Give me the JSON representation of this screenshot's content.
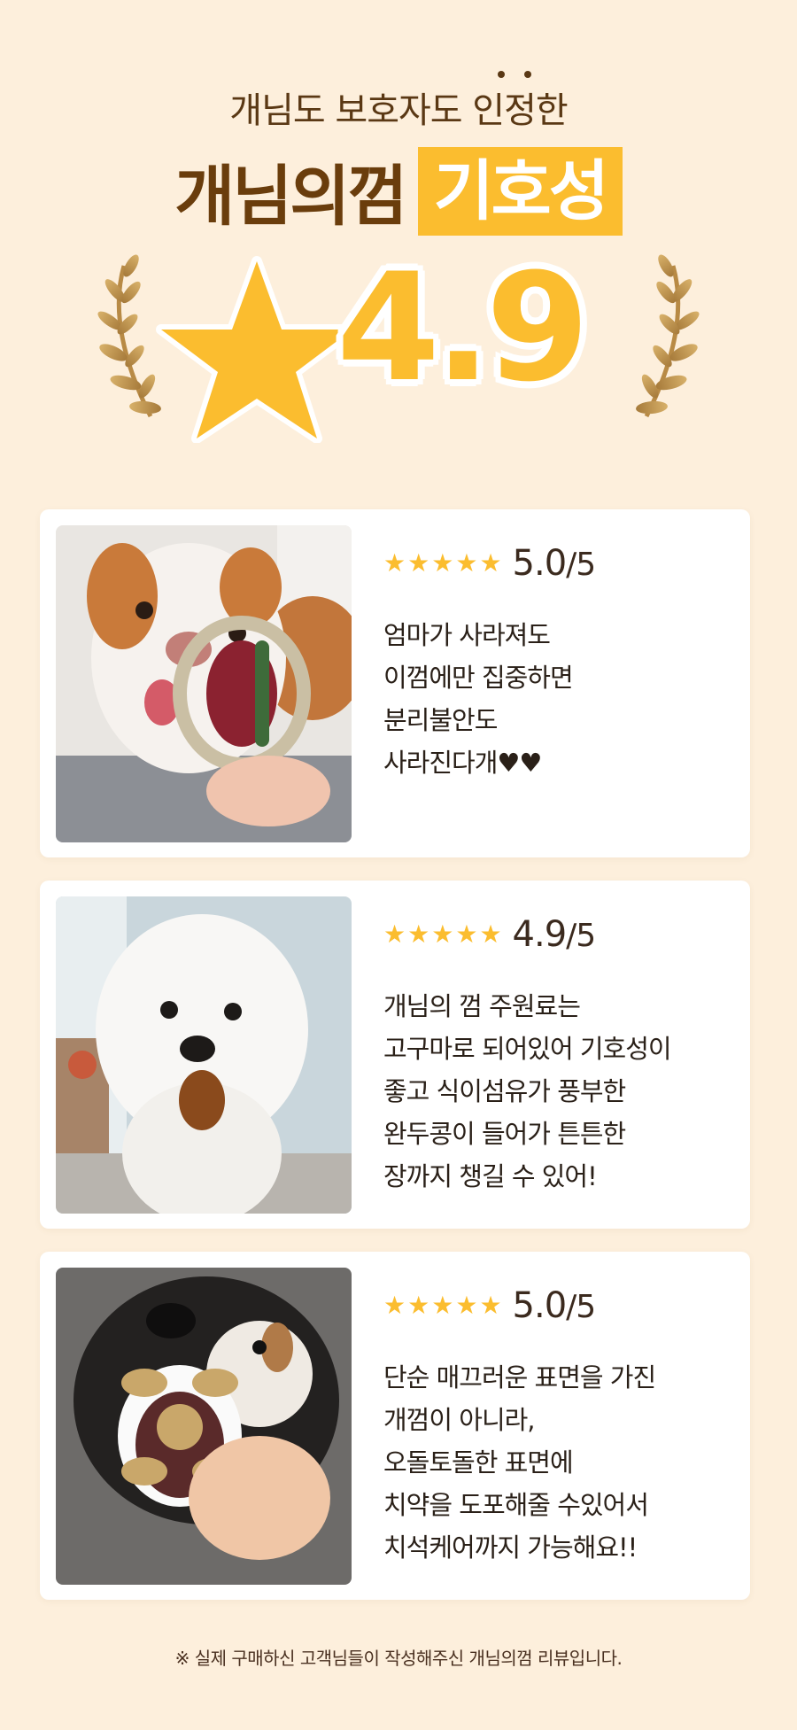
{
  "hero": {
    "subtitle": "개님도 보호자도 인정한",
    "title_main": "개님의껌",
    "title_highlight": "기호성",
    "rating": "4.9",
    "star_icon": "star-icon",
    "laurel_icon": "laurel-icon"
  },
  "reviews": [
    {
      "stars": "★★★★★",
      "score": "5.0",
      "score_den": "/5",
      "photo": "puppy-with-ring-chew-photo",
      "lines": [
        "엄마가 사라져도",
        "이껌에만 집중하면",
        "분리불안도",
        "사라진다개♥♥"
      ]
    },
    {
      "stars": "★★★★★",
      "score": "4.9",
      "score_den": "/5",
      "photo": "bichon-with-chew-photo",
      "lines": [
        "개님의 껌 주원료는",
        "고구마로 되어있어 기호성이",
        "좋고 식이섬유가 풍부한",
        "완두콩이 들어가 튼튼한",
        "장까지 챙길 수 있어!"
      ]
    },
    {
      "stars": "★★★★★",
      "score": "5.0",
      "score_den": "/5",
      "photo": "shiba-biting-chew-photo",
      "lines": [
        "단순 매끄러운 표면을 가진",
        "개껌이 아니라,",
        "오돌토돌한 표면에",
        "치약을 도포해줄 수있어서",
        "치석케어까지 가능해요!!"
      ]
    }
  ],
  "footnote": "※ 실제 구매하신 고객님들이 작성해주신 개님의껌 리뷰입니다.",
  "colors": {
    "background": "#fdefdc",
    "accent": "#fbbd2f",
    "brown": "#6a3d0c"
  }
}
